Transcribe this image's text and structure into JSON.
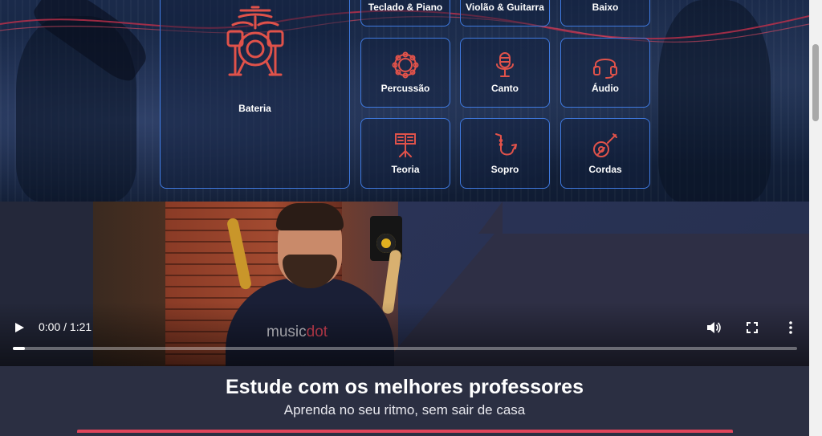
{
  "categories": {
    "big": {
      "label": "Bateria",
      "icon": "drum-kit-icon"
    },
    "items": [
      {
        "label": "Teclado & Piano",
        "icon": "keyboard-icon"
      },
      {
        "label": "Violão & Guitarra",
        "icon": "guitar-icon"
      },
      {
        "label": "Baixo",
        "icon": "bass-icon"
      },
      {
        "label": "Percussão",
        "icon": "tambourine-icon"
      },
      {
        "label": "Canto",
        "icon": "microphone-icon"
      },
      {
        "label": "Áudio",
        "icon": "headphones-icon"
      },
      {
        "label": "Teoria",
        "icon": "music-stand-icon"
      },
      {
        "label": "Sopro",
        "icon": "saxophone-icon"
      },
      {
        "label": "Cordas",
        "icon": "ukulele-icon"
      }
    ],
    "accent_color": "#e0524a",
    "border_color": "#3f7ae0"
  },
  "video": {
    "time": "0:00 / 1:21",
    "progress_fraction": 0.015,
    "brand_text": "music",
    "brand_dot": "dot",
    "controls": [
      "play-icon",
      "volume-icon",
      "fullscreen-icon",
      "more-vert-icon"
    ]
  },
  "cta": {
    "title": "Estude com os melhores professores",
    "subtitle": "Aprenda no seu ritmo, sem sair de casa",
    "underline_color": "#e0455a"
  }
}
